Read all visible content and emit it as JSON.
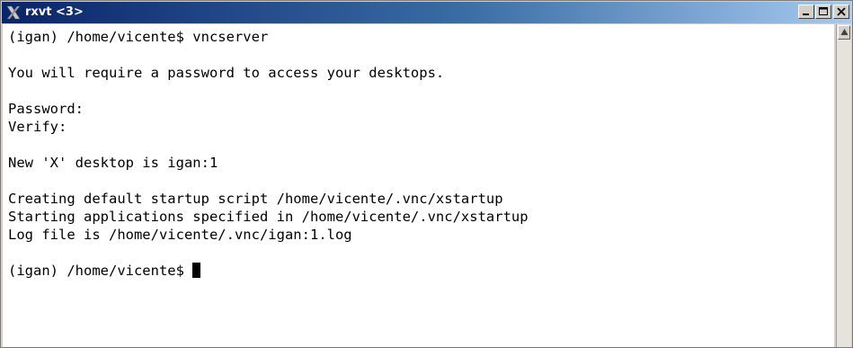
{
  "window": {
    "title": "rxvt <3>",
    "icon": "x-logo-icon",
    "buttons": [
      "minimize-icon",
      "maximize-icon",
      "close-icon"
    ]
  },
  "terminal": {
    "lines": [
      "(igan) /home/vicente$ vncserver",
      "",
      "You will require a password to access your desktops.",
      "",
      "Password:",
      "Verify:",
      "",
      "New 'X' desktop is igan:1",
      "",
      "Creating default startup script /home/vicente/.vnc/xstartup",
      "Starting applications specified in /home/vicente/.vnc/xstartup",
      "Log file is /home/vicente/.vnc/igan:1.log",
      "",
      "(igan) /home/vicente$ "
    ]
  },
  "colors": {
    "title_bar": "#0a246a",
    "terminal_bg": "#ffffff",
    "terminal_fg": "#000000"
  }
}
